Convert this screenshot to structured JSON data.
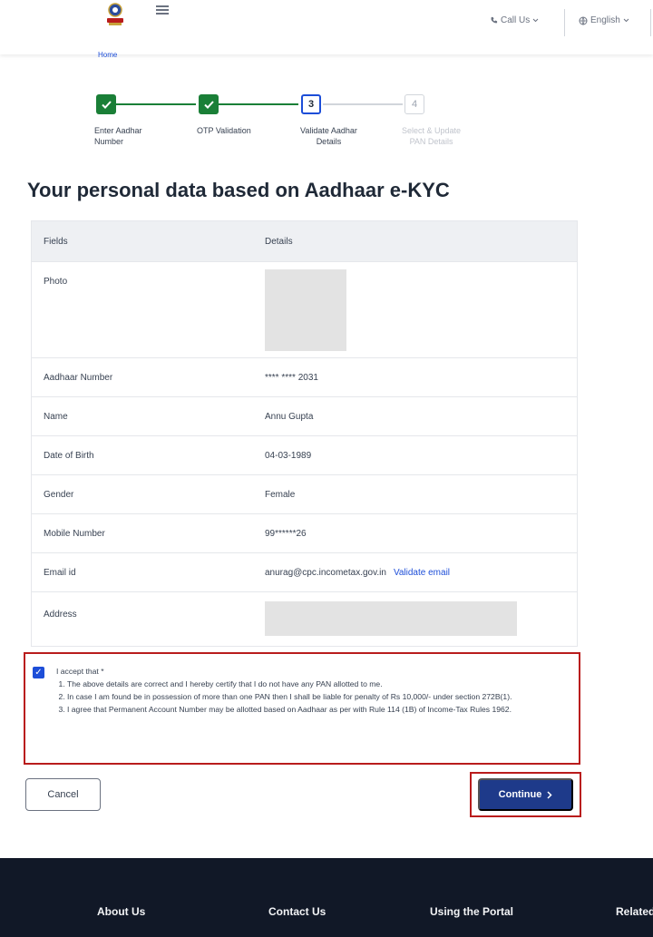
{
  "header": {
    "call_us": "Call Us",
    "language": "English"
  },
  "breadcrumb": "Home",
  "stepper": {
    "steps": [
      {
        "number": "1",
        "label_line1": "Enter Aadhar",
        "label_line2": "Number",
        "state": "done"
      },
      {
        "number": "2",
        "label_line1": "OTP Validation",
        "label_line2": "",
        "state": "done"
      },
      {
        "number": "3",
        "label_line1": "Validate Aadhar",
        "label_line2": "Details",
        "state": "current"
      },
      {
        "number": "4",
        "label_line1": "Select & Update",
        "label_line2": "PAN Details",
        "state": "future"
      }
    ]
  },
  "page_title": "Your personal data based on Aadhaar e-KYC",
  "table": {
    "col_fields": "Fields",
    "col_details": "Details",
    "rows": {
      "photo": {
        "label": "Photo"
      },
      "aadhaar": {
        "label": "Aadhaar Number",
        "value": "**** **** 2031"
      },
      "name": {
        "label": "Name",
        "value": "Annu Gupta"
      },
      "dob": {
        "label": "Date of Birth",
        "value": "04-03-1989"
      },
      "gender": {
        "label": "Gender",
        "value": "Female"
      },
      "mobile": {
        "label": "Mobile Number",
        "value": "99******26"
      },
      "email": {
        "label": "Email id",
        "value": "anurag@cpc.incometax.gov.in",
        "link": "Validate email"
      },
      "address": {
        "label": "Address"
      }
    }
  },
  "declaration": {
    "checked": true,
    "accept": "I accept that *",
    "items": [
      "The above details are correct and I hereby certify that I do not have any PAN allotted to me.",
      "In case I am found be in possession of more than one PAN then I shall be liable for penalty of Rs 10,000/- under section 272B(1).",
      "I agree that Permanent Account Number may be allotted based on Aadhaar as per with Rule 114 (1B) of Income-Tax Rules 1962."
    ]
  },
  "buttons": {
    "cancel": "Cancel",
    "continue": "Continue"
  },
  "footer": {
    "about": "About Us",
    "contact": "Contact Us",
    "using": "Using the Portal",
    "related": "Related"
  },
  "colors": {
    "primary": "#1e3a8a",
    "success": "#1a7f37",
    "highlight": "#b91c1c",
    "footer_bg": "#111827"
  }
}
